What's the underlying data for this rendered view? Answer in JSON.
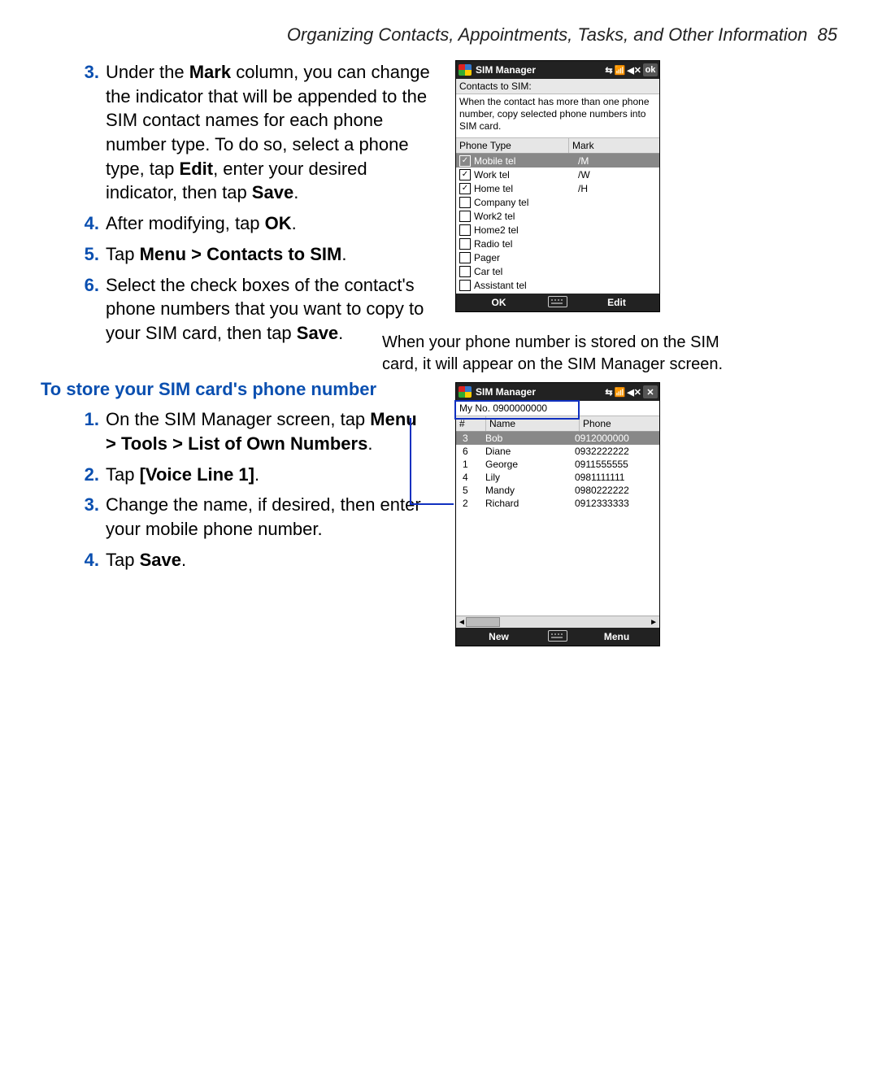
{
  "header": {
    "title": "Organizing Contacts, Appointments, Tasks, and Other Information",
    "page_number": "85"
  },
  "procedure1": {
    "items": [
      {
        "num": "3.",
        "pre": "Under the ",
        "b1": "Mark",
        "mid1": " column, you can change the indicator that will be appended to the SIM contact names for each phone number type. To do so, select a phone type, tap ",
        "b2": "Edit",
        "mid2": ", enter your desired indicator, then tap ",
        "b3": "Save",
        "post": "."
      },
      {
        "num": "4.",
        "pre": "After modifying, tap ",
        "b1": "OK",
        "post": "."
      },
      {
        "num": "5.",
        "pre": "Tap ",
        "b1": "Menu > Contacts to SIM",
        "post": "."
      },
      {
        "num": "6.",
        "pre": "Select the check boxes of the contact's phone numbers that you want to copy to your SIM card, then tap ",
        "b1": "Save",
        "post": "."
      }
    ]
  },
  "subhead1": "To store your SIM card's phone number",
  "procedure2": {
    "items": [
      {
        "num": "1.",
        "pre": "On the SIM Manager screen, tap ",
        "b1": "Menu > Tools > List of Own Numbers",
        "post": "."
      },
      {
        "num": "2.",
        "pre": "Tap ",
        "b1": "[Voice Line 1]",
        "post": "."
      },
      {
        "num": "3.",
        "pre": "Change the name, if desired, then enter your mobile phone number."
      },
      {
        "num": "4.",
        "pre": "Tap ",
        "b1": "Save",
        "post": "."
      }
    ]
  },
  "caption_right": "When your phone number is stored on the SIM card, it will appear on the SIM Manager screen.",
  "device1": {
    "title": "SIM Manager",
    "top_ok": "ok",
    "bar": "Contacts to SIM:",
    "info": "When the contact has more than one phone number, copy selected phone numbers into SIM card.",
    "head_col1": "Phone Type",
    "head_col2": "Mark",
    "rows": [
      {
        "checked": true,
        "selected": true,
        "label": "Mobile tel",
        "mark": "/M"
      },
      {
        "checked": true,
        "selected": false,
        "label": "Work tel",
        "mark": "/W"
      },
      {
        "checked": true,
        "selected": false,
        "label": "Home tel",
        "mark": "/H"
      },
      {
        "checked": false,
        "selected": false,
        "label": "Company tel",
        "mark": ""
      },
      {
        "checked": false,
        "selected": false,
        "label": "Work2 tel",
        "mark": ""
      },
      {
        "checked": false,
        "selected": false,
        "label": "Home2 tel",
        "mark": ""
      },
      {
        "checked": false,
        "selected": false,
        "label": "Radio tel",
        "mark": ""
      },
      {
        "checked": false,
        "selected": false,
        "label": "Pager",
        "mark": ""
      },
      {
        "checked": false,
        "selected": false,
        "label": "Car tel",
        "mark": ""
      },
      {
        "checked": false,
        "selected": false,
        "label": "Assistant tel",
        "mark": ""
      }
    ],
    "bottom_left": "OK",
    "bottom_right": "Edit"
  },
  "device2": {
    "title": "SIM Manager",
    "my_no": "My No. 0900000000",
    "head_idx": "#",
    "head_name": "Name",
    "head_phone": "Phone",
    "rows": [
      {
        "selected": true,
        "idx": "3",
        "name": "Bob",
        "phone": "0912000000"
      },
      {
        "selected": false,
        "idx": "6",
        "name": "Diane",
        "phone": "0932222222"
      },
      {
        "selected": false,
        "idx": "1",
        "name": "George",
        "phone": "0911555555"
      },
      {
        "selected": false,
        "idx": "4",
        "name": "Lily",
        "phone": "0981111111"
      },
      {
        "selected": false,
        "idx": "5",
        "name": "Mandy",
        "phone": "0980222222"
      },
      {
        "selected": false,
        "idx": "2",
        "name": "Richard",
        "phone": "0912333333"
      }
    ],
    "bottom_left": "New",
    "bottom_right": "Menu",
    "scroll_left": "◄",
    "scroll_right": "►"
  },
  "icons": {
    "sync": "⇆",
    "signal": "📶",
    "speaker": "◀✕",
    "close": "✕"
  }
}
